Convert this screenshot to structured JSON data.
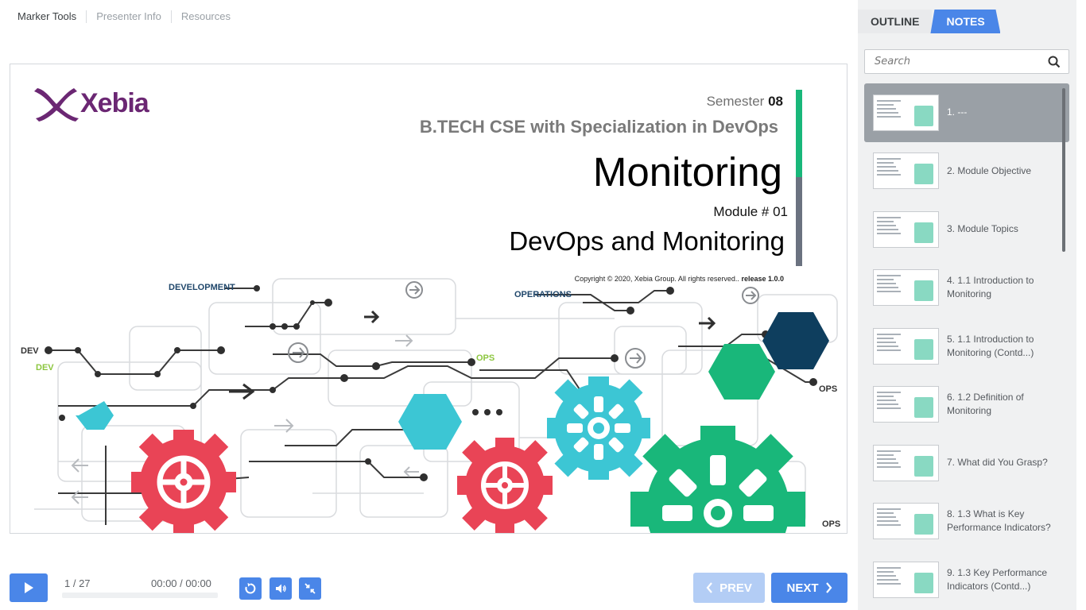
{
  "topnav": {
    "items": [
      "Marker Tools",
      "Presenter Info",
      "Resources"
    ]
  },
  "slide": {
    "logo": "Xebia",
    "semester_label": "Semester",
    "semester_number": "08",
    "program": "B.TECH CSE with Specialization in DevOps",
    "title": "Monitoring",
    "module_number": "Module # 01",
    "subtitle": "DevOps and Monitoring",
    "copyright": "Copyright © 2020, Xebia Group. All rights reserved..",
    "release": "release 1.0.0",
    "labels": {
      "development": "DEVELOPMENT",
      "operations": "OPERATIONS",
      "dev_dark": "DEV",
      "dev_green": "DEV",
      "ops_green": "OPS",
      "ops_right": "OPS",
      "ops_bottom": "OPS"
    },
    "colors": {
      "red_gear": "#e94456",
      "teal_gear": "#3cc6d4",
      "green_gear": "#19b77a",
      "navy_hex": "#0e3e5e",
      "accent_bar_green": "#19b77a",
      "accent_bar_gray": "#6b7280"
    }
  },
  "player": {
    "counter": "1 / 27",
    "time": "00:00 / 00:00",
    "progress": 0,
    "play_icon": "play-icon",
    "replay_icon": "replay-icon",
    "volume_icon": "volume-icon",
    "collapse_icon": "collapse-icon",
    "prev_label": "PREV",
    "next_label": "NEXT"
  },
  "sidebar": {
    "tabs": [
      "OUTLINE",
      "NOTES"
    ],
    "active_tab": "NOTES",
    "search_placeholder": "Search",
    "items": [
      {
        "label": "1. ---",
        "active": true
      },
      {
        "label": "2. Module Objective",
        "active": false
      },
      {
        "label": "3. Module Topics",
        "active": false
      },
      {
        "label": "4. 1.1 Introduction to Monitoring",
        "active": false
      },
      {
        "label": "5. 1.1 Introduction to Monitoring (Contd...)",
        "active": false
      },
      {
        "label": "6. 1.2 Definition of Monitoring",
        "active": false
      },
      {
        "label": "7. What did You Grasp?",
        "active": false
      },
      {
        "label": "8. 1.3 What is Key Performance Indicators?",
        "active": false
      },
      {
        "label": "9. 1.3 Key Performance Indicators (Contd...)",
        "active": false
      }
    ]
  },
  "accent_color": "#4a86e8"
}
